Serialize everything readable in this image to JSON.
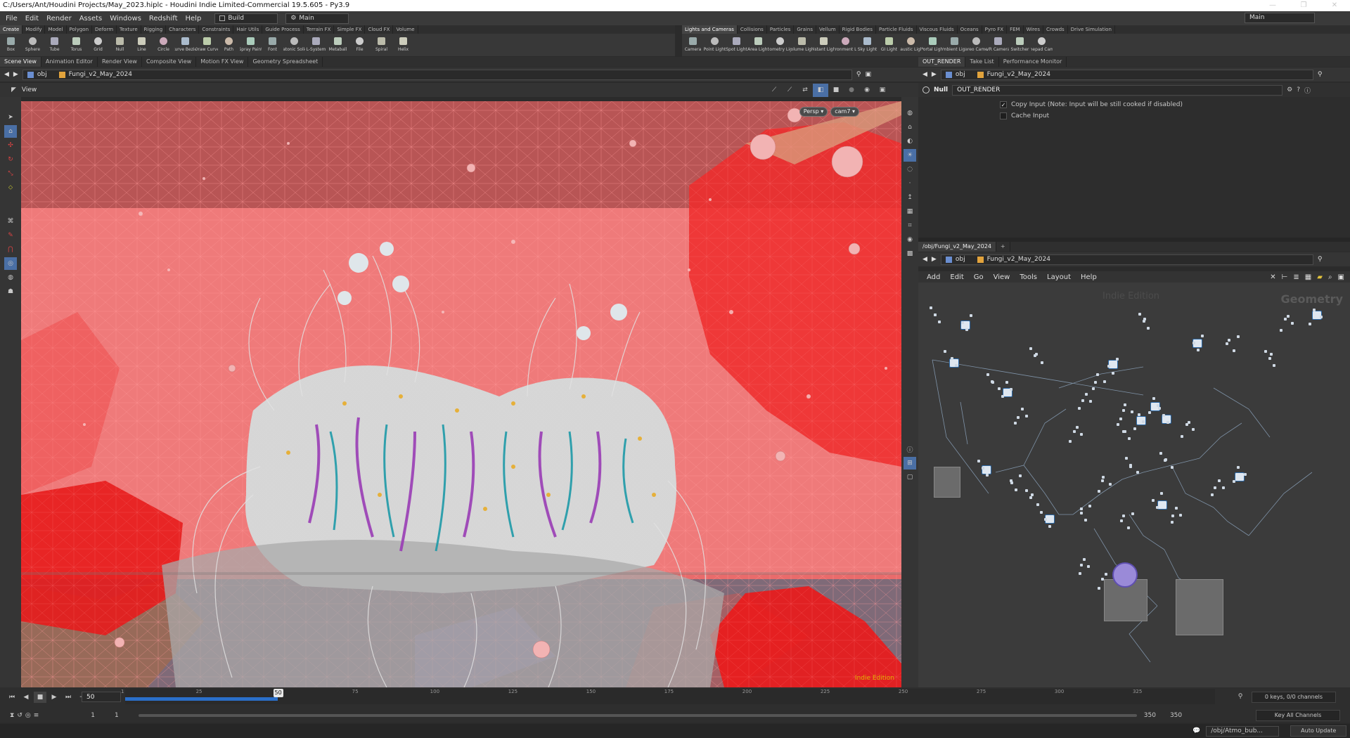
{
  "window": {
    "title": "C:/Users/Ant/Houdini Projects/May_2023.hiplc - Houdini Indie Limited-Commercial 19.5.605 - Py3.9",
    "controls": [
      "—",
      "❐",
      "✕"
    ]
  },
  "menubar": {
    "items": [
      "File",
      "Edit",
      "Render",
      "Assets",
      "Windows",
      "Redshift",
      "Help"
    ],
    "desktop_left": "Build",
    "desktop_center": "Main",
    "desktop_right": "Main"
  },
  "shelf_left": {
    "tabs": [
      "Create",
      "Modify",
      "Model",
      "Polygon",
      "Deform",
      "Texture",
      "Rigging",
      "Characters",
      "Constraints",
      "Hair Utils",
      "Guide Process",
      "Terrain FX",
      "Simple FX",
      "Cloud FX",
      "Volume"
    ],
    "tools": [
      "Box",
      "Sphere",
      "Tube",
      "Torus",
      "Grid",
      "Null",
      "Line",
      "Circle",
      "Curve Bezier",
      "Draw Curve",
      "Path",
      "Spray Paint",
      "Font",
      "Platonic Solids",
      "L-System",
      "Metaball",
      "File",
      "Spiral",
      "Helix"
    ]
  },
  "shelf_right": {
    "tabs": [
      "Lights and Cameras",
      "Collisions",
      "Particles",
      "Grains",
      "Vellum",
      "Rigid Bodies",
      "Particle Fluids",
      "Viscous Fluids",
      "Oceans",
      "Pyro FX",
      "FEM",
      "Wires",
      "Crowds",
      "Drive Simulation"
    ],
    "tools": [
      "Camera",
      "Point Light",
      "Spot Light",
      "Area Light",
      "Geometry Light",
      "Volume Light",
      "Distant Light",
      "Environment Light",
      "Sky Light",
      "GI Light",
      "Caustic Light",
      "Portal Light",
      "Ambient Light",
      "Stereo Camera",
      "VR Camera",
      "Switcher",
      "Gamepad Camera"
    ]
  },
  "left_pane": {
    "tabs": [
      "Scene View",
      "Animation Editor",
      "Render View",
      "Composite View",
      "Motion FX View",
      "Geometry Spreadsheet"
    ],
    "path": {
      "context": "obj",
      "node": "Fungi_v2_May_2024"
    },
    "viewport": {
      "label": "View",
      "persp": "Persp",
      "camera": "cam7",
      "watermark": "Indie Edition"
    }
  },
  "params_pane": {
    "tabs": [
      "OUT_RENDER",
      "Take List",
      "Performance Monitor"
    ],
    "path": {
      "context": "obj",
      "node": "Fungi_v2_May_2024"
    },
    "node_type": "Null",
    "node_name": "OUT_RENDER",
    "params": [
      {
        "label": "Copy Input (Note: Input will be still cooked if disabled)",
        "checked": true
      },
      {
        "label": "Cache Input",
        "checked": false
      }
    ]
  },
  "network_pane": {
    "tab": "/obj/Fungi_v2_May_2024",
    "path": {
      "context": "obj",
      "node": "Fungi_v2_May_2024"
    },
    "menu": [
      "Add",
      "Edit",
      "Go",
      "View",
      "Tools",
      "Layout",
      "Help"
    ],
    "watermark": "Indie Edition",
    "context_label": "Geometry"
  },
  "timeline": {
    "current_frame": "50",
    "ticks": [
      "1",
      "25",
      "50",
      "75",
      "100",
      "125",
      "150",
      "175",
      "200",
      "225",
      "250",
      "275",
      "300",
      "325"
    ],
    "start": "1",
    "start2": "1",
    "end": "350",
    "end2": "350",
    "playhead": "50",
    "range_fraction": 0.14,
    "keys_info": "0 keys, 0/0 channels",
    "key_channels": "Key All Channels"
  },
  "statusbar": {
    "path": "/obj/Atmo_bub...",
    "update": "Auto Update"
  },
  "colors": {
    "accent_blue": "#2a6fc9",
    "viewport_red": "#e94b4b",
    "indie_text": "#e0b200"
  }
}
